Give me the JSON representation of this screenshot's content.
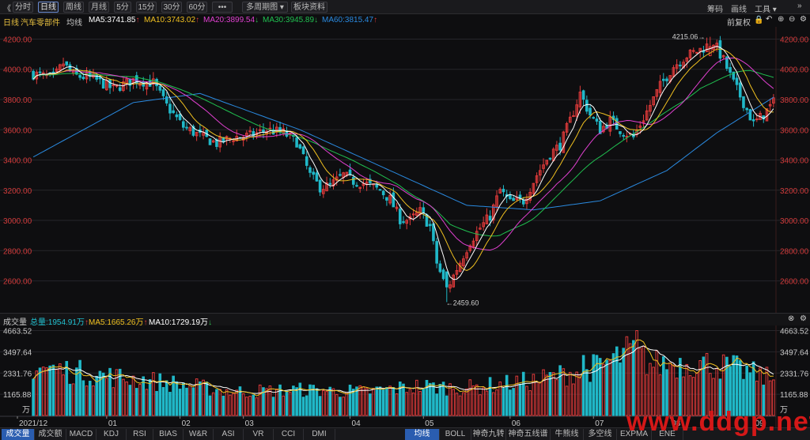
{
  "toolbar": {
    "back_glyph": "《",
    "periods": [
      "分时",
      "日线",
      "周线",
      "月线",
      "5分",
      "15分",
      "30分",
      "60分",
      "•••"
    ],
    "active_period": "日线",
    "multi_period": "多周期图",
    "board_info": "板块资料",
    "right": [
      "筹码",
      "画线",
      "工具"
    ],
    "right_icon": "double-chevron-icon"
  },
  "info": {
    "period_label": "日线",
    "sector_name": "汽车零部件",
    "ma_type": "均线",
    "ma5": "MA5:3741.85",
    "ma10": "MA10:3743.02",
    "ma20": "MA20:3899.54",
    "ma30": "MA30:3945.89",
    "ma60": "MA60:3815.47",
    "fq": "前复权",
    "colors": {
      "ma5": "#ffffff",
      "ma10": "#f0c020",
      "ma20": "#e040d0",
      "ma30": "#20c050",
      "ma60": "#2a8ae0",
      "up": "#e03a3a",
      "down": "#20b8c8"
    }
  },
  "volume": {
    "label": "成交量",
    "total": "总量:1954.91万",
    "ma5": "MA5:1665.26万",
    "ma10": "MA10:1729.19万",
    "unit": "万"
  },
  "tabs_left": [
    "成交量",
    "成交额",
    "MACD",
    "KDJ",
    "RSI",
    "BIAS",
    "W&R",
    "ASI",
    "VR",
    "CCI",
    "DMI"
  ],
  "tabs_right": [
    "均线",
    "BOLL",
    "神奇九转",
    "神奇五线谱",
    "牛熊线",
    "多空线",
    "EXPMA",
    "ENE"
  ],
  "watermark": "www.ddgp.net",
  "chart_data": [
    {
      "type": "candlestick",
      "title": "汽车零部件 日线",
      "y_ticks": [
        2600,
        2800,
        3000,
        3200,
        3400,
        3600,
        3800,
        4000,
        4200
      ],
      "y_tick_labels": [
        "2600.00",
        "2800.00",
        "3000.00",
        "3200.00",
        "3400.00",
        "3600.00",
        "3800.00",
        "4000.00",
        "4200.00"
      ],
      "ylim": [
        2420,
        4260
      ],
      "x_labels": [
        "2021/12",
        "01",
        "02",
        "03",
        "04",
        "05",
        "06",
        "07",
        "08",
        "09"
      ],
      "annotations": [
        {
          "text": "4215.06→",
          "value": 4215.06
        },
        {
          "text": "←2459.60",
          "value": 2459.6
        }
      ],
      "close_path": [
        [
          0,
          3970
        ],
        [
          6,
          3940
        ],
        [
          9,
          4040
        ],
        [
          12,
          3960
        ],
        [
          18,
          3940
        ],
        [
          24,
          3870
        ],
        [
          30,
          3930
        ],
        [
          36,
          3910
        ],
        [
          40,
          3760
        ],
        [
          45,
          3620
        ],
        [
          50,
          3560
        ],
        [
          55,
          3510
        ],
        [
          60,
          3550
        ],
        [
          65,
          3560
        ],
        [
          70,
          3600
        ],
        [
          75,
          3580
        ],
        [
          79,
          3520
        ],
        [
          83,
          3300
        ],
        [
          86,
          3220
        ],
        [
          89,
          3230
        ],
        [
          93,
          3300
        ],
        [
          96,
          3260
        ],
        [
          100,
          3240
        ],
        [
          104,
          3200
        ],
        [
          107,
          3140
        ],
        [
          110,
          3010
        ],
        [
          113,
          3000
        ],
        [
          116,
          3060
        ],
        [
          119,
          2960
        ],
        [
          121,
          2720
        ],
        [
          124,
          2540
        ],
        [
          127,
          2680
        ],
        [
          131,
          2860
        ],
        [
          134,
          2950
        ],
        [
          137,
          3030
        ],
        [
          140,
          3200
        ],
        [
          143,
          3120
        ],
        [
          147,
          3130
        ],
        [
          151,
          3300
        ],
        [
          155,
          3440
        ],
        [
          158,
          3500
        ],
        [
          161,
          3660
        ],
        [
          164,
          3840
        ],
        [
          167,
          3700
        ],
        [
          170,
          3600
        ],
        [
          173,
          3660
        ],
        [
          176,
          3600
        ],
        [
          180,
          3550
        ],
        [
          184,
          3720
        ],
        [
          188,
          3890
        ],
        [
          192,
          4020
        ],
        [
          196,
          4090
        ],
        [
          200,
          4130
        ],
        [
          204,
          4180
        ],
        [
          207,
          4060
        ],
        [
          210,
          3910
        ],
        [
          213,
          3780
        ],
        [
          216,
          3640
        ],
        [
          219,
          3700
        ],
        [
          222,
          3780
        ]
      ],
      "ma_hint": {
        "ma60": [
          [
            0,
            3420
          ],
          [
            30,
            3780
          ],
          [
            50,
            3840
          ],
          [
            80,
            3600
          ],
          [
            110,
            3300
          ],
          [
            130,
            3100
          ],
          [
            150,
            3070
          ],
          [
            170,
            3130
          ],
          [
            190,
            3330
          ],
          [
            205,
            3580
          ],
          [
            222,
            3815
          ]
        ],
        "ma30": [
          [
            0,
            3960
          ],
          [
            30,
            3950
          ],
          [
            50,
            3820
          ],
          [
            80,
            3540
          ],
          [
            110,
            3220
          ],
          [
            125,
            2920
          ],
          [
            140,
            2910
          ],
          [
            160,
            3250
          ],
          [
            180,
            3560
          ],
          [
            200,
            3930
          ],
          [
            215,
            3990
          ],
          [
            222,
            3946
          ]
        ]
      }
    },
    {
      "type": "bar",
      "title": "成交量",
      "y_tick_labels": [
        "4663.52",
        "3497.64",
        "2331.76",
        "1165.88"
      ],
      "y_ticks": [
        4663.52,
        3497.64,
        2331.76,
        1165.88
      ],
      "ylim": [
        0,
        4860
      ],
      "unit": "万",
      "last_total": 1954.91
    }
  ]
}
